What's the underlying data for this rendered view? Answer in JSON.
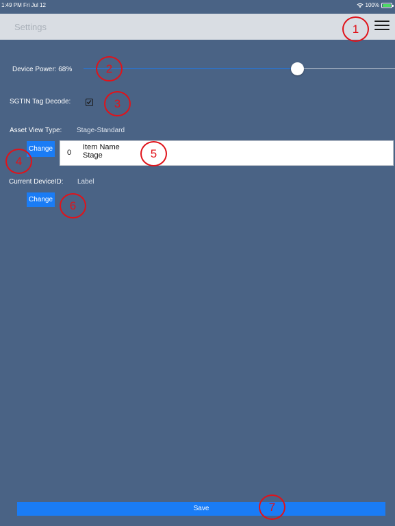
{
  "status_bar": {
    "time": "1:49 PM  Fri Jul 12",
    "battery": "100%",
    "wifi_icon": "wifi-icon",
    "battery_icon": "battery-icon"
  },
  "nav": {
    "title": "Settings",
    "menu_icon": "hamburger-menu-icon"
  },
  "device_power": {
    "label": "Device Power: 68%",
    "value": 0.68
  },
  "sgtin": {
    "label": "SGTIN Tag Decode:",
    "checked": true
  },
  "asset_view": {
    "label": "Asset View Type:",
    "value": "Stage-Standard",
    "change_label": "Change",
    "preview": {
      "number": "0",
      "name": "Item Name",
      "stage": "Stage"
    }
  },
  "device_id": {
    "label": "Current DeviceID:",
    "value": "Label",
    "change_label": "Change"
  },
  "save_label": "Save",
  "markers": [
    "1",
    "2",
    "3",
    "4",
    "5",
    "6",
    "7"
  ],
  "colors": {
    "background": "#4a6385",
    "nav_bar": "#d9dde3",
    "accent": "#1a7cf5",
    "annotation": "#e0131a"
  }
}
